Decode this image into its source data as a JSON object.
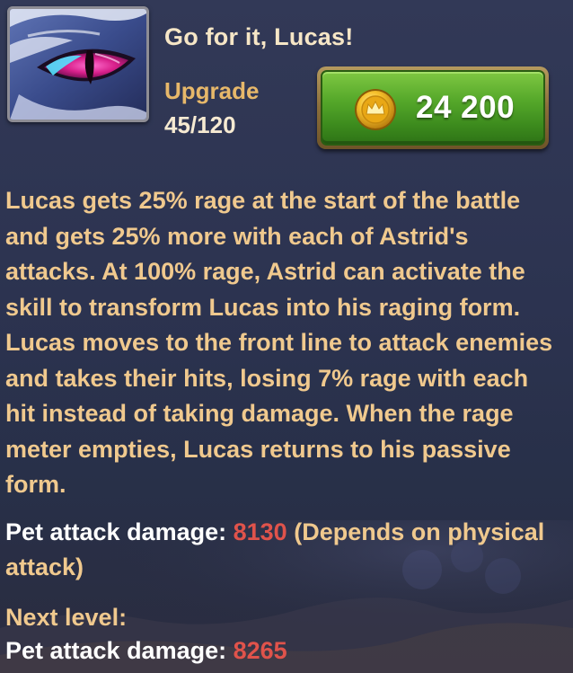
{
  "skill": {
    "title": "Go for it, Lucas!",
    "icon": "dragon-eye-icon"
  },
  "upgrade": {
    "label": "Upgrade",
    "progress": "45/120"
  },
  "upgrade_button": {
    "cost": "24 200",
    "currency_icon": "gold-coin-crown-icon"
  },
  "description": "Lucas gets 25% rage at the start of the battle and gets 25% more with each of Astrid's attacks. At 100% rage, Astrid can activate the skill to transform Lucas into his raging form. Lucas moves to the front line to attack enemies and takes their hits, losing 7% rage with each hit instead of taking damage. When the rage meter empties, Lucas returns to his passive form.",
  "current_stat": {
    "label": "Pet attack damage:",
    "value": "8130",
    "note": "(Depends on physical attack)"
  },
  "next_level": {
    "label": "Next level:",
    "stat_label": "Pet attack damage:",
    "stat_value": "8265"
  },
  "colors": {
    "title": "#f6e6c6",
    "accent_gold": "#e7b86a",
    "body_text": "#f0c98e",
    "value_red": "#e0534b",
    "button_green": "#55a82a"
  }
}
